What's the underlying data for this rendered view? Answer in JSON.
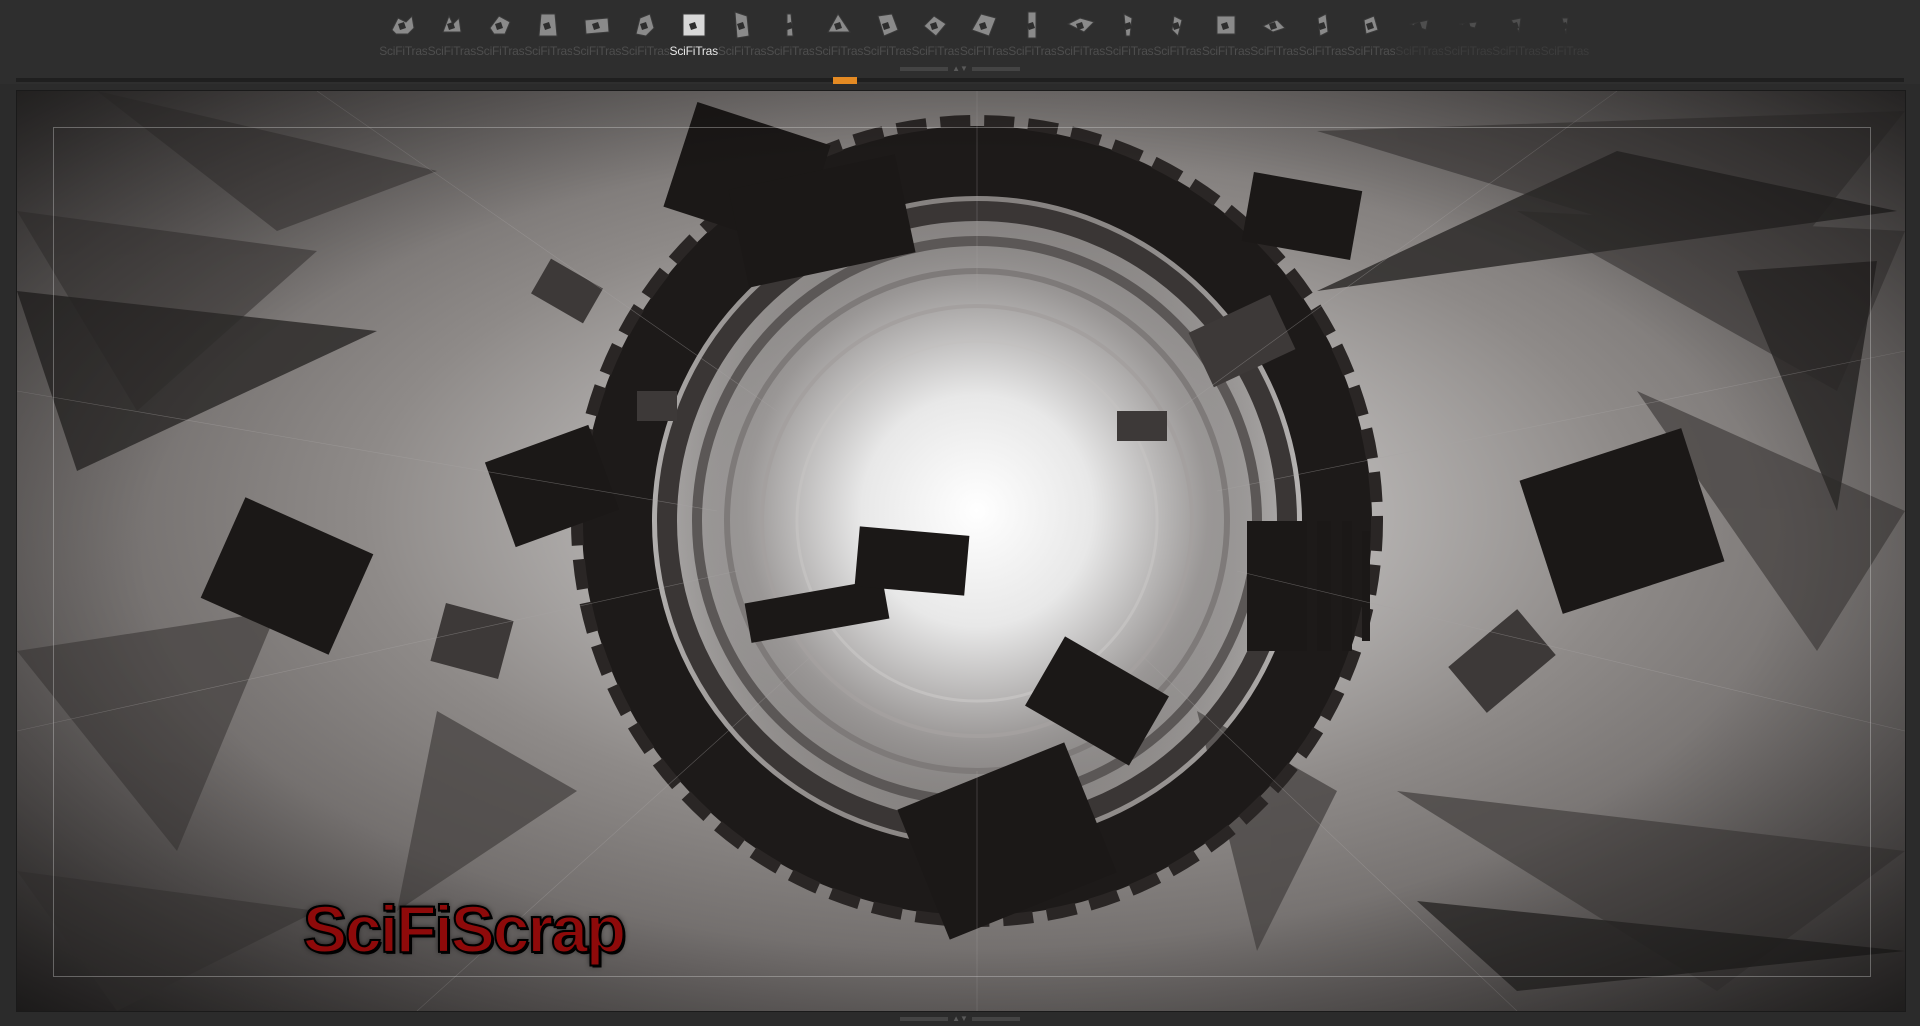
{
  "shelf": {
    "items": [
      {
        "label": "SciFiTrash",
        "icon": "scifi-scrap-thumbnail"
      },
      {
        "label": "SciFiTrash",
        "icon": "scifi-scrap-thumbnail"
      },
      {
        "label": "SciFiTrash",
        "icon": "scifi-scrap-thumbnail"
      },
      {
        "label": "SciFiTrash",
        "icon": "scifi-scrap-thumbnail"
      },
      {
        "label": "SciFiTrash",
        "icon": "scifi-scrap-thumbnail"
      },
      {
        "label": "SciFiTrash",
        "icon": "scifi-scrap-thumbnail"
      },
      {
        "label": "SciFiTrash",
        "icon": "scifi-scrap-thumbnail",
        "selected": true
      },
      {
        "label": "SciFiTrash",
        "icon": "scifi-scrap-thumbnail"
      },
      {
        "label": "SciFiTrash",
        "icon": "scifi-scrap-thumbnail"
      },
      {
        "label": "SciFiTrash",
        "icon": "scifi-scrap-thumbnail"
      },
      {
        "label": "SciFiTrash",
        "icon": "scifi-scrap-thumbnail"
      },
      {
        "label": "SciFiTrash",
        "icon": "scifi-scrap-thumbnail"
      },
      {
        "label": "SciFiTrash",
        "icon": "scifi-scrap-thumbnail"
      },
      {
        "label": "SciFiTrash",
        "icon": "scifi-scrap-thumbnail"
      },
      {
        "label": "SciFiTrash",
        "icon": "scifi-scrap-thumbnail"
      },
      {
        "label": "SciFiTrash",
        "icon": "scifi-scrap-thumbnail"
      },
      {
        "label": "SciFiTrash",
        "icon": "scifi-scrap-thumbnail"
      },
      {
        "label": "SciFiTrash",
        "icon": "scifi-scrap-thumbnail"
      },
      {
        "label": "SciFiTrash",
        "icon": "scifi-scrap-thumbnail"
      },
      {
        "label": "SciFiTrash",
        "icon": "scifi-scrap-thumbnail"
      },
      {
        "label": "SciFiTrash",
        "icon": "scifi-scrap-thumbnail"
      },
      {
        "label": "SciFiTrash",
        "icon": "scifi-scrap-thumbnail",
        "dim": true
      },
      {
        "label": "SciFiTrash",
        "icon": "scifi-scrap-thumbnail",
        "dim": true
      },
      {
        "label": "SciFiTrash",
        "icon": "scifi-scrap-thumbnail",
        "dim": true
      },
      {
        "label": "SciFiTrash",
        "icon": "scifi-scrap-thumbnail",
        "dim": true
      }
    ],
    "toggle_icon": "collapse-arrows-icon"
  },
  "viewport": {
    "watermark": "SciFiScrap",
    "scene": "scifi-tunnel-render"
  },
  "colors": {
    "accent": "#e48a23",
    "watermark": "#8e0a0a",
    "background": "#2b2b2b",
    "label_inactive": "#4e4e4e",
    "label_selected": "#e6e6e6"
  }
}
